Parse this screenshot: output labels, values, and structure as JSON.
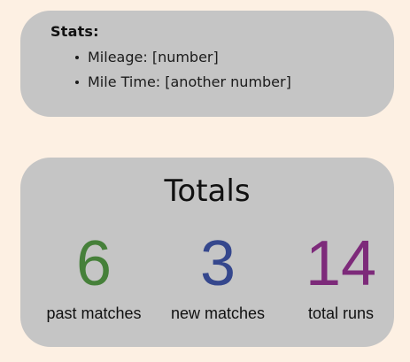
{
  "stats": {
    "heading": "Stats:",
    "items": [
      "Mileage: [number]",
      "Mile Time: [another number]"
    ]
  },
  "totals": {
    "title": "Totals",
    "metrics": [
      {
        "value": "6",
        "label": "past matches",
        "color": "#46803a"
      },
      {
        "value": "3",
        "label": "new matches",
        "color": "#35478d"
      },
      {
        "value": "14",
        "label": "total runs",
        "color": "#7d2a7a"
      }
    ]
  },
  "colors": {
    "background": "#fdf0e3",
    "card": "#c5c5c5"
  }
}
